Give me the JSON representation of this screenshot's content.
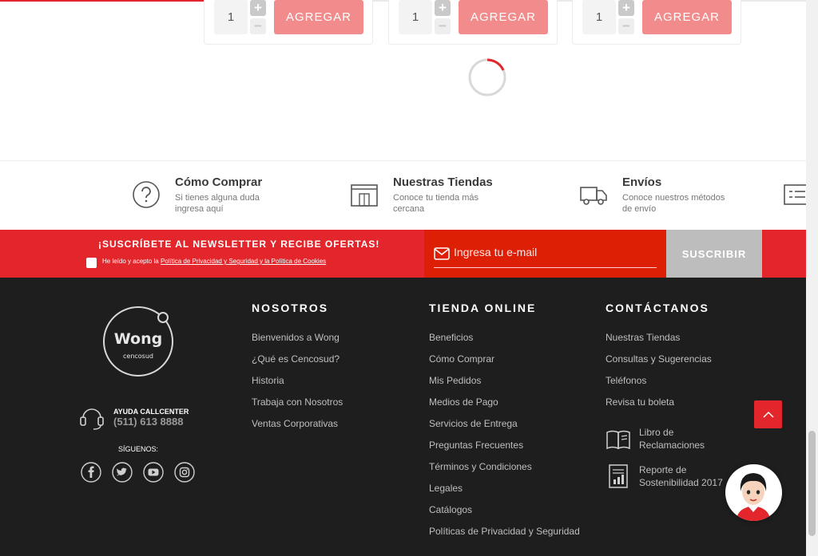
{
  "products": [
    {
      "qty": "1",
      "plus": "+",
      "minus": "−",
      "add_label": "AGREGAR"
    },
    {
      "qty": "1",
      "plus": "+",
      "minus": "−",
      "add_label": "AGREGAR"
    },
    {
      "qty": "1",
      "plus": "+",
      "minus": "−",
      "add_label": "AGREGAR"
    }
  ],
  "info": [
    {
      "title": "Cómo Comprar",
      "sub": "Si tienes alguna duda ingresa aquí",
      "icon": "question-icon"
    },
    {
      "title": "Nuestras Tiendas",
      "sub": "Conoce tu tienda más cercana",
      "icon": "store-icon"
    },
    {
      "title": "Envíos",
      "sub": "Conoce nuestros métodos de envío",
      "icon": "truck-icon"
    }
  ],
  "newsletter": {
    "title": "¡SUSCRÍBETE AL NEWSLETTER Y RECIBE OFERTAS!",
    "legal_prefix": "He leído y acepto la ",
    "legal_link": "Política de Privacidad y Seguridad y la Política de Cookies",
    "email_placeholder": "Ingresa tu e-mail",
    "button": "SUSCRIBIR"
  },
  "footer": {
    "logo_text": "Wong",
    "logo_sub": "cencosud",
    "call_label": "AYUDA CALLCENTER",
    "call_phone": "(511) 613 8888",
    "follow": "SÍGUENOS:",
    "columns": [
      {
        "title": "NOSOTROS",
        "links": [
          "Bienvenidos a Wong",
          "¿Qué es Cencosud?",
          "Historia",
          "Trabaja con Nosotros",
          "Ventas Corporativas"
        ]
      },
      {
        "title": "TIENDA ONLINE",
        "links": [
          "Beneficios",
          "Cómo Comprar",
          "Mis Pedidos",
          "Medios de Pago",
          "Servicios de Entrega",
          "Preguntas Frecuentes",
          "Términos y Condiciones",
          "Legales",
          "Catálogos",
          "Políticas de Privacidad y Seguridad"
        ]
      },
      {
        "title": "CONTÁCTANOS",
        "links": [
          "Nuestras Tiendas",
          "Consultas y Sugerencias",
          "Teléfonos",
          "Revisa tu boleta"
        ],
        "icon_links": [
          "Libro de Reclamaciones",
          "Reporte de Sostenibilidad 2017"
        ]
      }
    ]
  },
  "colors": {
    "brand_red": "#e2262b",
    "footer_bg": "#1e1e1e"
  }
}
